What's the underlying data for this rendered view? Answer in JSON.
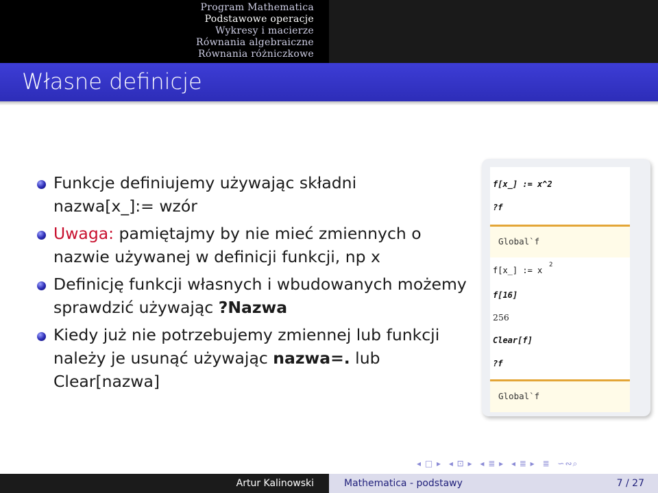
{
  "nav": {
    "items": [
      "Program Mathematica",
      "Podstawowe operacje",
      "Wykresy i macierze",
      "Równania algebraiczne",
      "Równania różniczkowe"
    ]
  },
  "slide": {
    "title": "Własne definicje",
    "bullets": [
      {
        "text1": "Funkcje definiujemy używając składni",
        "text2": "nazwa[x_]:= wzór"
      },
      {
        "red": "Uwaga:",
        "text1": " pamiętajmy by nie mieć zmiennych o",
        "text2": "nazwie używanej w definicji funkcji, np x"
      },
      {
        "text1": "Definicję funkcji własnych i wbudowanych możemy",
        "text2a": "sprawdzić używając ",
        "text2b": "?Nazwa"
      },
      {
        "text1": "Kiedy już nie potrzebujemy zmiennej lub funkcji",
        "text2a": "należy je usunąć używając ",
        "text2b": "nazwa=.",
        "text2c": " lub",
        "text3": "Clear[nazwa]"
      }
    ]
  },
  "notebook": {
    "lines": [
      "f[x_] := x^2",
      "?f",
      "Global`f",
      "f[x_] := x",
      "2",
      "f[16]",
      "256",
      "Clear[f]",
      "?f",
      "Global`f"
    ]
  },
  "beamer_nav": [
    "◂ □ ▸",
    "◂ ⊡ ▸",
    "◂ ≣ ▸",
    "◂ ≣ ▸",
    "≣",
    "∽∾⌕"
  ],
  "footer": {
    "author": "Artur Kalinowski",
    "title": "Mathematica - podstawy",
    "page": "7 / 27"
  }
}
